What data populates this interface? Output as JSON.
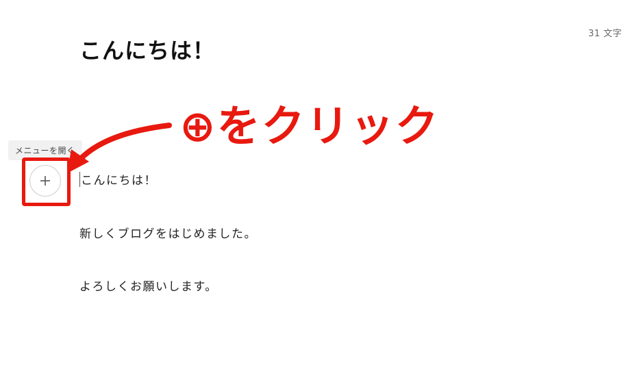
{
  "header": {
    "char_count": "31 文字",
    "title": "こんにちは！"
  },
  "tooltip": {
    "label": "メニューを開く"
  },
  "editor": {
    "paragraphs": [
      "こんにちは！",
      "新しくブログをはじめました。",
      "よろしくお願いします。"
    ]
  },
  "annotation": {
    "callout_text": "⊕をクリック",
    "color": "#e8190f"
  },
  "icons": {
    "menu_button_icon": "plus-icon"
  }
}
